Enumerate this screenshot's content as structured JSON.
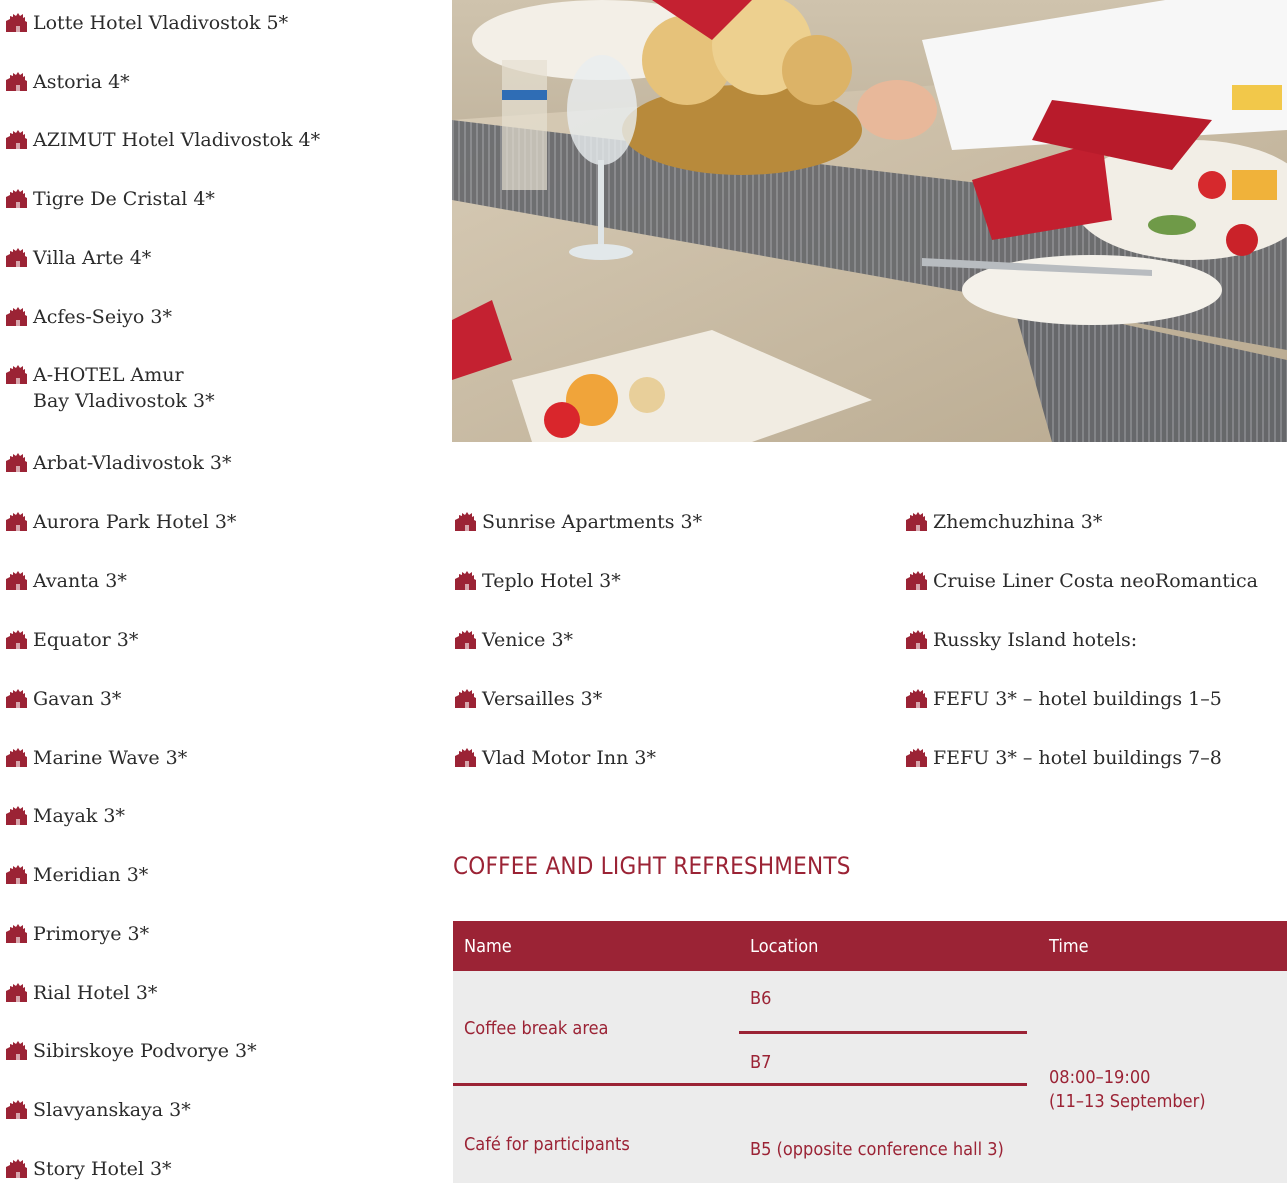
{
  "hotels": [
    "Lotte Hotel Vladivostok 5*",
    "Astoria 4*",
    "AZIMUT Hotel Vladivostok 4*",
    "Tigre De Cristal 4*",
    "Villa Arte 4*",
    "Acfes-Seiyo 3*",
    "A-HOTEL Amur\nBay Vladivostok 3*",
    "Arbat-Vladivostok 3*",
    "Aurora Park Hotel 3*",
    "Avanta 3*",
    "Equator 3*",
    "Gavan 3*",
    "Marine Wave 3*",
    "Mayak 3*",
    "Meridian 3*",
    "Primorye 3*",
    "Rial Hotel 3*",
    "Sibirskoye Podvorye 3*",
    "Slavyanskaya 3*",
    "Story Hotel 3*",
    "Sunrise Apartments 3*",
    "Teplo Hotel 3*",
    "Venice 3*",
    "Versailles 3*",
    "Vlad Motor Inn 3*",
    "Zhemchuzhina 3*",
    "Cruise Liner Costa neoRomantica",
    "Russky Island hotels:",
    "FEFU 3* – hotel buildings 1–5",
    "FEFU 3* – hotel buildings 7–8"
  ],
  "section_title": "COFFEE AND LIGHT REFRESHMENTS",
  "table": {
    "headers": [
      "Name",
      "Location",
      "Time"
    ],
    "rows": [
      {
        "name": "Coffee break area",
        "locations": [
          "B6",
          "B7"
        ]
      },
      {
        "name": "Café for participants",
        "locations": [
          "B5 (opposite conference hall 3)"
        ]
      }
    ],
    "time": "08:00–19:00\n(11–13 September)"
  },
  "colors": {
    "accent": "#9b2335",
    "table_bg": "#ececec"
  },
  "icons": {
    "hotel": "hotel-building-icon",
    "photo": "restaurant-table-photo"
  }
}
